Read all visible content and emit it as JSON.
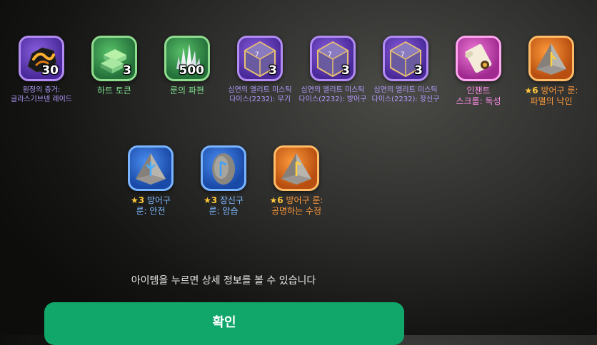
{
  "items": [
    {
      "icon": "proof-of-expedition-icon",
      "qty": "30",
      "label_lines": [
        "원정의 증거:",
        "글라스기브넨 레이드"
      ]
    },
    {
      "icon": "heart-token-icon",
      "qty": "3",
      "label_lines": [
        "하트 토큰"
      ]
    },
    {
      "icon": "rune-fragment-icon",
      "qty": "500",
      "label_lines": [
        "룬의 파편"
      ]
    },
    {
      "icon": "mystic-dice-icon",
      "qty": "3",
      "label_lines": [
        "심연의 엘리트 미스틱",
        "다이스(2232): 무기"
      ]
    },
    {
      "icon": "mystic-dice-icon",
      "qty": "3",
      "label_lines": [
        "심연의 엘리트 미스틱",
        "다이스(2232): 방어구"
      ]
    },
    {
      "icon": "mystic-dice-icon",
      "qty": "3",
      "label_lines": [
        "심연의 엘리트 미스틱",
        "다이스(2232): 장신구"
      ]
    },
    {
      "icon": "enchant-scroll-icon",
      "qty": "",
      "label_lines": [
        "인챈트",
        "스크롤: 독성"
      ]
    },
    {
      "icon": "rune-stone-icon",
      "qty": "",
      "star": "★6",
      "label_lines": [
        " 방어구 룬:",
        "파멸의 낙인"
      ]
    },
    {
      "icon": "rune-stone-icon",
      "qty": "",
      "star": "★3",
      "label_lines": [
        " 방어구",
        "룬: 안전"
      ]
    },
    {
      "icon": "rune-stone-icon",
      "qty": "",
      "star": "★3",
      "label_lines": [
        " 장신구",
        "룬: 암습"
      ]
    },
    {
      "icon": "rune-stone-icon",
      "qty": "",
      "star": "★6",
      "label_lines": [
        " 방어구 룬:",
        "공명하는 수정"
      ]
    }
  ],
  "hint": "아이템을 누르면 상세 정보를 볼 수 있습니다",
  "confirm_label": "확인",
  "colors": {
    "confirm": "#11a66a",
    "purple": "#b49cff",
    "green": "#7fe08f",
    "pink": "#ff8ee8",
    "orange": "#ff9a3c",
    "blue": "#7fb8ff",
    "star": "#ffc83a"
  }
}
